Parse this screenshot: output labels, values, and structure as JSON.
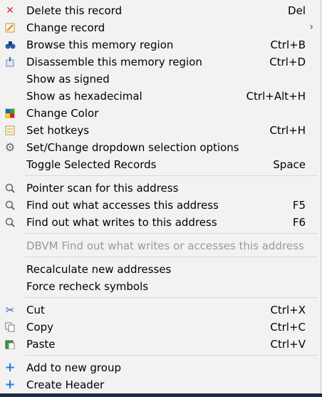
{
  "menu": {
    "group1": [
      {
        "label": "Delete this record",
        "shortcut": "Del",
        "icon": "delete-x-icon"
      },
      {
        "label": "Change record",
        "shortcut": "",
        "icon": "edit-icon",
        "submenu": "›"
      },
      {
        "label": "Browse this memory region",
        "shortcut": "Ctrl+B",
        "icon": "binoculars-icon"
      },
      {
        "label": "Disassemble this memory region",
        "shortcut": "Ctrl+D",
        "icon": "disassemble-icon"
      },
      {
        "label": "Show as signed",
        "shortcut": ""
      },
      {
        "label": "Show as hexadecimal",
        "shortcut": "Ctrl+Alt+H"
      },
      {
        "label": "Change Color",
        "shortcut": "",
        "icon": "color-palette-icon"
      },
      {
        "label": "Set hotkeys",
        "shortcut": "Ctrl+H",
        "icon": "hotkey-icon"
      },
      {
        "label": "Set/Change dropdown selection options",
        "shortcut": "",
        "icon": "gear-icon"
      },
      {
        "label": "Toggle Selected Records",
        "shortcut": "Space"
      }
    ],
    "group2": [
      {
        "label": "Pointer scan for this address",
        "shortcut": "",
        "icon": "magnifier-icon"
      },
      {
        "label": "Find out what accesses this address",
        "shortcut": "F5",
        "icon": "find-access-icon"
      },
      {
        "label": "Find out what writes to this address",
        "shortcut": "F6",
        "icon": "find-write-icon"
      }
    ],
    "group3": [
      {
        "label": "DBVM Find out what writes or accesses this address",
        "shortcut": "",
        "disabled": true
      }
    ],
    "group4": [
      {
        "label": "Recalculate new addresses",
        "shortcut": ""
      },
      {
        "label": "Force recheck symbols",
        "shortcut": ""
      }
    ],
    "group5": [
      {
        "label": "Cut",
        "shortcut": "Ctrl+X",
        "icon": "scissors-icon"
      },
      {
        "label": "Copy",
        "shortcut": "Ctrl+C",
        "icon": "copy-icon"
      },
      {
        "label": "Paste",
        "shortcut": "Ctrl+V",
        "icon": "paste-icon"
      }
    ],
    "group6": [
      {
        "label": "Add to new group",
        "shortcut": "",
        "icon": "plus-icon"
      },
      {
        "label": "Create Header",
        "shortcut": "",
        "icon": "plus-icon"
      }
    ]
  },
  "colors": {
    "delete_red": "#e0282e",
    "plus_blue": "#2b79d8",
    "disabled_text": "#9a9a9a"
  }
}
